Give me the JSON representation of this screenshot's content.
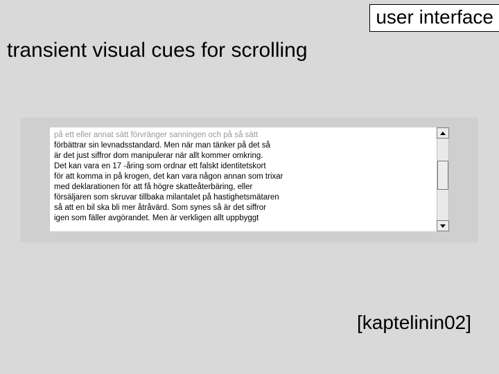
{
  "header": {
    "label": "user interface"
  },
  "title": "transient visual cues for scrolling",
  "textbox": {
    "dim_line": "på ett eller annat sätt förvränger sanningen och på så sätt",
    "lines": [
      "förbättrar sin levnadsstandard. Men när man tänker på det så",
      "är det just siffror dom manipulerar när allt kommer omkring.",
      "Det kan  vara en 17 -åring som ordnar ett falskt identitetskort",
      "för att komma in på krogen, det kan vara någon annan som trixar",
      "med deklarationen för att få högre skatteåterbäring, eller",
      "försäljaren som skruvar tillbaka milantalet på hastighetsmätaren",
      "så att en bil ska bli mer åtråvärd. Som synes så är det siffror",
      "igen som fäller avgörandet. Men är verkligen allt uppbyggt"
    ]
  },
  "citation": "[kaptelinin02]"
}
